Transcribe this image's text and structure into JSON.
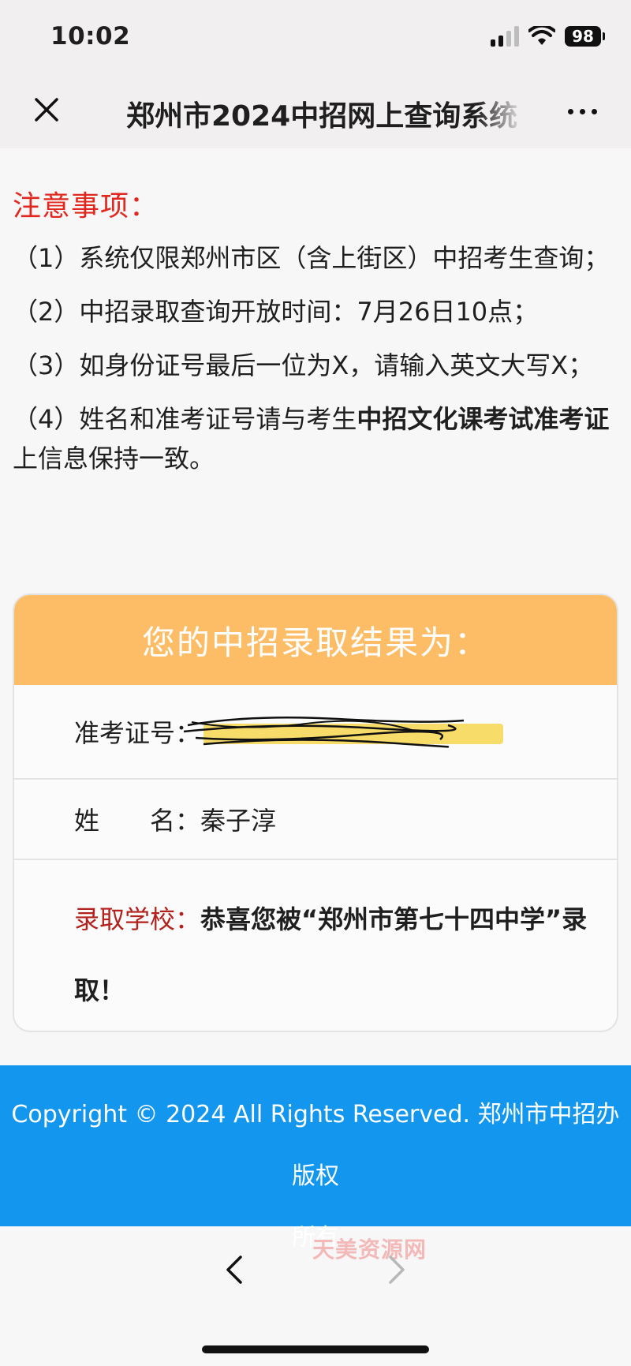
{
  "status_bar": {
    "time": "10:02",
    "battery": "98"
  },
  "header": {
    "title": "郑州市2024中招网上查询系统",
    "close_icon": "close-icon",
    "more_icon": "more-horizontal-icon"
  },
  "notice": {
    "title": "注意事项：",
    "items": [
      "（1）系统仅限郑州市区（含上街区）中招考生查询；",
      "（2）中招录取查询开放时间：7月26日10点；",
      "（3）如身份证号最后一位为X，请输入英文大写X；"
    ],
    "item4_prefix": "（4）姓名和准考证号请与考生",
    "item4_bold": "中招文化课考试准考证",
    "item4_suffix": "上信息保持一致。"
  },
  "result": {
    "heading": "您的中招录取结果为：",
    "exam_id_label": "准考证号：",
    "name_label": "姓　　名：",
    "name_value": "秦子淳",
    "school_label": "录取学校：",
    "school_text": "恭喜您被“郑州市第七十四中学”录取！",
    "header_color": "#fdbd67",
    "school_label_color": "#b2211c"
  },
  "footer": {
    "line1": "Copyright © 2024 All Rights Reserved. 郑州市中招办 版权",
    "line2": "所有",
    "color": "#1396ee"
  },
  "watermark": "天美资源网",
  "nav": {
    "back_icon": "chevron-left-icon",
    "forward_icon": "chevron-right-icon"
  }
}
